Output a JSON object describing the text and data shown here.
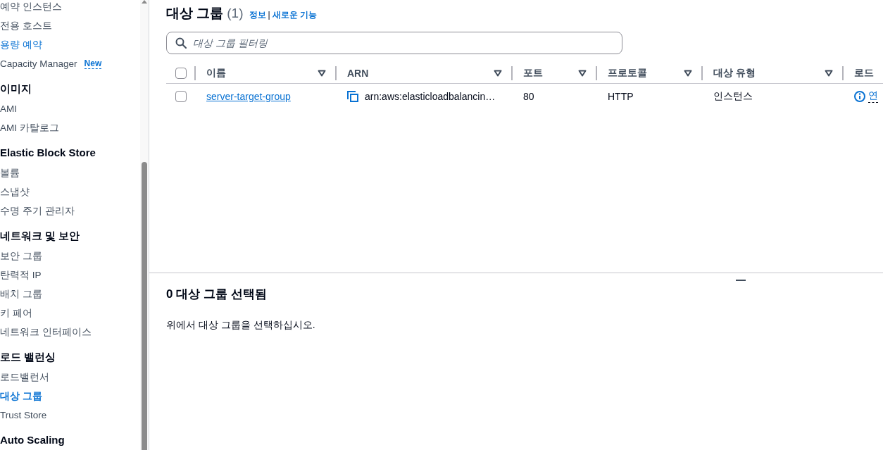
{
  "sidebar": {
    "sections": [
      {
        "items": [
          {
            "label": "예약 인스턴스",
            "selected": false,
            "hovered": false
          },
          {
            "label": "전용 호스트",
            "selected": false,
            "hovered": false
          },
          {
            "label": "용량 예약",
            "selected": false,
            "hovered": true
          },
          {
            "label": "Capacity Manager",
            "selected": false,
            "hovered": false,
            "badge": "New"
          }
        ]
      },
      {
        "heading": "이미지",
        "items": [
          {
            "label": "AMI",
            "selected": false,
            "hovered": false
          },
          {
            "label": "AMI 카탈로그",
            "selected": false,
            "hovered": false
          }
        ]
      },
      {
        "heading": "Elastic Block Store",
        "items": [
          {
            "label": "볼륨",
            "selected": false,
            "hovered": false
          },
          {
            "label": "스냅샷",
            "selected": false,
            "hovered": false
          },
          {
            "label": "수명 주기 관리자",
            "selected": false,
            "hovered": false
          }
        ]
      },
      {
        "heading": "네트워크 및 보안",
        "items": [
          {
            "label": "보안 그룹",
            "selected": false,
            "hovered": false
          },
          {
            "label": "탄력적 IP",
            "selected": false,
            "hovered": false
          },
          {
            "label": "배치 그룹",
            "selected": false,
            "hovered": false
          },
          {
            "label": "키 페어",
            "selected": false,
            "hovered": false
          },
          {
            "label": "네트워크 인터페이스",
            "selected": false,
            "hovered": false
          }
        ]
      },
      {
        "heading": "로드 밸런싱",
        "items": [
          {
            "label": "로드밸런서",
            "selected": false,
            "hovered": false
          },
          {
            "label": "대상 그룹",
            "selected": true,
            "hovered": false
          },
          {
            "label": "Trust Store",
            "selected": false,
            "hovered": false
          }
        ]
      },
      {
        "heading": "Auto Scaling"
      }
    ]
  },
  "header": {
    "title": "대상 그룹",
    "count": "(1)",
    "links": [
      "정보",
      "새로운 기능"
    ],
    "link_separator": "|"
  },
  "search": {
    "placeholder": "대상 그룹 필터링"
  },
  "table": {
    "select_all_checked": false,
    "columns": [
      {
        "label": "이름",
        "sortable": true
      },
      {
        "label": "ARN",
        "sortable": true
      },
      {
        "label": "포트",
        "sortable": true
      },
      {
        "label": "프로토콜",
        "sortable": true
      },
      {
        "label": "대상 유형",
        "sortable": true
      },
      {
        "label": "로드",
        "sortable": false
      }
    ],
    "rows": [
      {
        "selected": false,
        "cells": [
          {
            "kind": "link",
            "text": "server-target-group"
          },
          {
            "kind": "copyable",
            "text": "arn:aws:elasticloadbalancin…"
          },
          {
            "kind": "text",
            "text": "80"
          },
          {
            "kind": "text",
            "text": "HTTP"
          },
          {
            "kind": "text",
            "text": "인스턴스"
          },
          {
            "kind": "info_link",
            "text": "연"
          }
        ]
      }
    ]
  },
  "details": {
    "heading": "0 대상 그룹 선택됨",
    "message": "위에서 대상 그룹을 선택하십시오."
  }
}
